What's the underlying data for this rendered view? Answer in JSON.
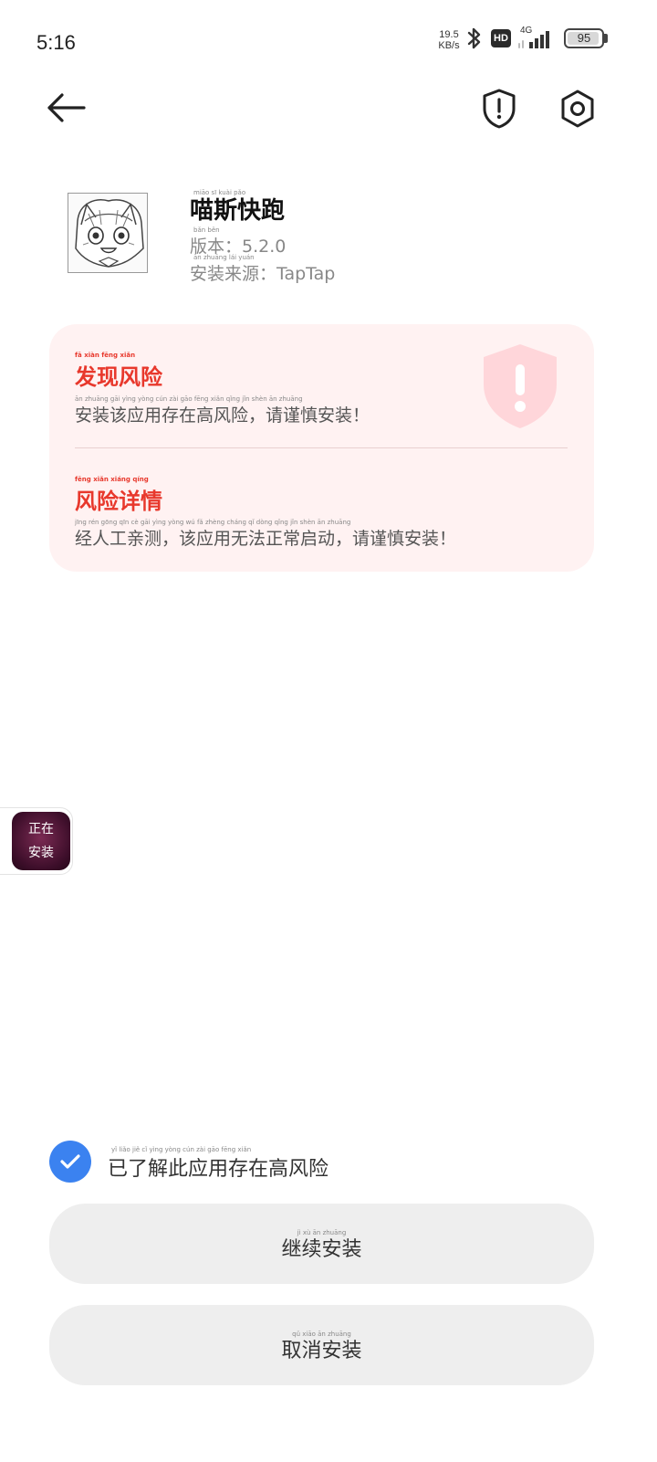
{
  "status_bar": {
    "time": "5:16",
    "net_speed_value": "19.5",
    "net_speed_unit": "KB/s",
    "network_type": "4G",
    "hd_label": "HD",
    "battery_percent": "95",
    "battery_level": 0.95
  },
  "nav": {
    "back_icon": "arrow-left-icon",
    "shield_icon": "shield-alert-icon",
    "settings_icon": "settings-icon"
  },
  "app": {
    "name_pinyin": "miāo   sī   kuài   pǎo",
    "name": "喵斯快跑",
    "version_pinyin": "bǎn   běn",
    "version_label": "版本：",
    "version": "5.2.0",
    "source_pinyin": "ān  zhuāng  lái   yuán",
    "source_label": "安装来源：",
    "source": "TapTap"
  },
  "risk": {
    "title_pinyin": "fā    xiàn   fēng   xiǎn",
    "title": "发现风险",
    "desc_pinyin": "ān  zhuāng  gāi   yìng yòng  cún   zài   gāo  fēng  xiǎn          qǐng   jǐn   shèn   ān  zhuāng",
    "desc": "安装该应用存在高风险，请谨慎安装！",
    "detail_title_pinyin": "fēng   xiǎn  xiáng  qíng",
    "detail_title": "风险详情",
    "detail_pinyin": "jīng   rén  gōng   qīn   cè         gāi  yìng  yòng  wú    fǎ  zhèng cháng  qǐ    dòng          qǐng   jǐn   shèn   ān  zhuāng",
    "detail_desc": "经人工亲测，该应用无法正常启动，请谨慎安装！"
  },
  "installing": {
    "line1": "正在",
    "line2": "安装"
  },
  "ack": {
    "checked": true,
    "text_pinyin": "yǐ    liǎo   jiě    cǐ   yìng yòng  cún   zài   gāo  fēng  xiǎn",
    "text": "已了解此应用存在高风险"
  },
  "buttons": {
    "continue_pinyin": "jì     xù     ān   zhuāng",
    "continue_label": "继续安装",
    "cancel_pinyin": "qǔ    xiāo    ān   zhuāng",
    "cancel_label": "取消安装"
  },
  "colors": {
    "accent_blue": "#3b82f0",
    "risk_red": "#e8382c",
    "risk_card_bg": "#fff2f2",
    "button_bg": "#eeeeee"
  }
}
